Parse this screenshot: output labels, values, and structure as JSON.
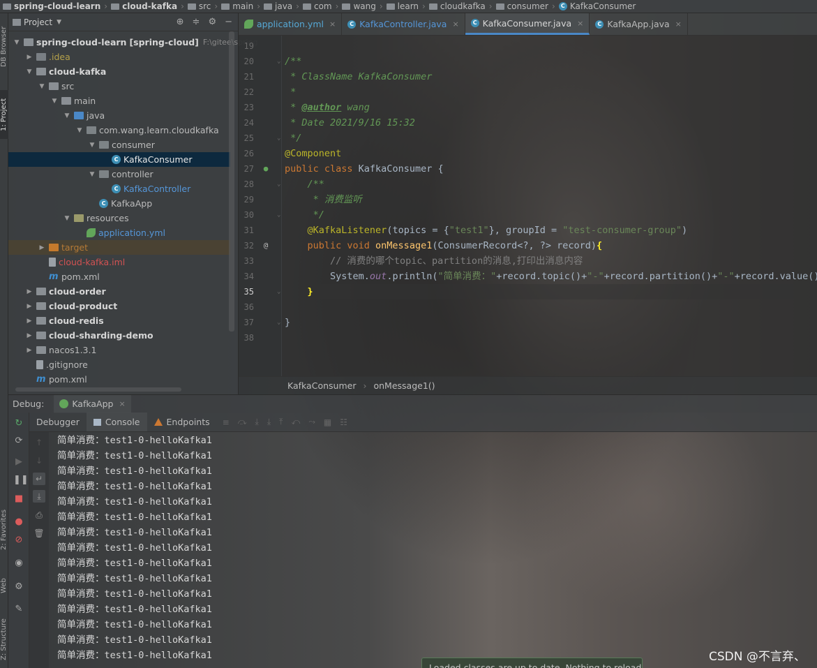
{
  "breadcrumb": [
    {
      "label": "spring-cloud-learn",
      "bold": true,
      "icon": "folder-icon"
    },
    {
      "label": "cloud-kafka",
      "bold": true,
      "icon": "folder-icon"
    },
    {
      "label": "src",
      "icon": "folder-icon"
    },
    {
      "label": "main",
      "icon": "folder-icon"
    },
    {
      "label": "java",
      "icon": "folder-icon"
    },
    {
      "label": "com",
      "icon": "folder-icon"
    },
    {
      "label": "wang",
      "icon": "folder-icon"
    },
    {
      "label": "learn",
      "icon": "folder-icon"
    },
    {
      "label": "cloudkafka",
      "icon": "folder-icon"
    },
    {
      "label": "consumer",
      "icon": "folder-icon"
    },
    {
      "label": "KafkaConsumer",
      "icon": "class-icon"
    }
  ],
  "left_stripe": {
    "db_browser": "DB Browser",
    "project": "1: Project",
    "favorites": "2: Favorites",
    "web": "Web",
    "structure": "Z: Structure"
  },
  "project_panel": {
    "title": "Project",
    "tree": [
      {
        "label": "spring-cloud-learn",
        "bold_suffix": "[spring-cloud]",
        "path": "F:\\gitee\\spring",
        "depth": 0,
        "expanded": true,
        "icon": "folder-icon",
        "style": "root"
      },
      {
        "label": ".idea",
        "depth": 1,
        "expanded": false,
        "icon": "folder-icon",
        "style": "yellow"
      },
      {
        "label": "cloud-kafka",
        "depth": 1,
        "expanded": true,
        "icon": "folder-icon",
        "style": "module"
      },
      {
        "label": "src",
        "depth": 2,
        "expanded": true,
        "icon": "folder-icon",
        "style": "plain"
      },
      {
        "label": "main",
        "depth": 3,
        "expanded": true,
        "icon": "folder-icon",
        "style": "plain"
      },
      {
        "label": "java",
        "depth": 4,
        "expanded": true,
        "icon": "folder-blue-icon",
        "style": "plain"
      },
      {
        "label": "com.wang.learn.cloudkafka",
        "depth": 5,
        "expanded": true,
        "icon": "package-icon",
        "style": "plain"
      },
      {
        "label": "consumer",
        "depth": 6,
        "expanded": true,
        "icon": "package-icon",
        "style": "plain"
      },
      {
        "label": "KafkaConsumer",
        "depth": 7,
        "icon": "class-icon",
        "style": "selected"
      },
      {
        "label": "controller",
        "depth": 6,
        "expanded": true,
        "icon": "package-icon",
        "style": "plain"
      },
      {
        "label": "KafkaController",
        "depth": 7,
        "icon": "class-icon",
        "style": "blue"
      },
      {
        "label": "KafkaApp",
        "depth": 6,
        "icon": "spring-class-icon",
        "style": "plain"
      },
      {
        "label": "resources",
        "depth": 4,
        "expanded": true,
        "icon": "resources-folder-icon",
        "style": "plain"
      },
      {
        "label": "application.yml",
        "depth": 5,
        "icon": "yml-icon",
        "style": "blue"
      },
      {
        "label": "target",
        "depth": 2,
        "expanded": false,
        "icon": "folder-orange-icon",
        "style": "target"
      },
      {
        "label": "cloud-kafka.iml",
        "depth": 2,
        "icon": "iml-file-icon",
        "style": "red"
      },
      {
        "label": "pom.xml",
        "depth": 2,
        "icon": "maven-icon",
        "style": "plain"
      },
      {
        "label": "cloud-order",
        "depth": 1,
        "expanded": false,
        "icon": "folder-icon",
        "style": "module"
      },
      {
        "label": "cloud-product",
        "depth": 1,
        "expanded": false,
        "icon": "folder-icon",
        "style": "module"
      },
      {
        "label": "cloud-redis",
        "depth": 1,
        "expanded": false,
        "icon": "folder-icon",
        "style": "module"
      },
      {
        "label": "cloud-sharding-demo",
        "depth": 1,
        "expanded": false,
        "icon": "folder-icon",
        "style": "module"
      },
      {
        "label": "nacos1.3.1",
        "depth": 1,
        "expanded": false,
        "icon": "folder-icon",
        "style": "plain"
      },
      {
        "label": ".gitignore",
        "depth": 1,
        "icon": "file-icon",
        "style": "plain"
      },
      {
        "label": "pom.xml",
        "depth": 1,
        "icon": "maven-icon",
        "style": "plain"
      }
    ]
  },
  "editor_tabs": [
    {
      "label": "application.yml",
      "icon": "yml-icon",
      "style": "yml"
    },
    {
      "label": "KafkaController.java",
      "icon": "class-icon",
      "style": "cls"
    },
    {
      "label": "KafkaConsumer.java",
      "icon": "class-icon",
      "style": "active"
    },
    {
      "label": "KafkaApp.java",
      "icon": "spring-class-icon",
      "style": "plain"
    }
  ],
  "code": {
    "current_line": 35,
    "lines": [
      {
        "no": 19,
        "tokens": []
      },
      {
        "no": 20,
        "tokens": [
          {
            "t": "/**",
            "c": "doc"
          }
        ]
      },
      {
        "no": 21,
        "tokens": [
          {
            "t": " * ClassName KafkaConsumer",
            "c": "doc"
          }
        ]
      },
      {
        "no": 22,
        "tokens": [
          {
            "t": " *",
            "c": "doc"
          }
        ]
      },
      {
        "no": 23,
        "tokens": [
          {
            "t": " * ",
            "c": "doc"
          },
          {
            "t": "@author",
            "c": "tag"
          },
          {
            "t": " wang",
            "c": "doc"
          }
        ]
      },
      {
        "no": 24,
        "tokens": [
          {
            "t": " * Date 2021/9/16 15:32",
            "c": "doc"
          }
        ]
      },
      {
        "no": 25,
        "tokens": [
          {
            "t": " */",
            "c": "doc"
          }
        ]
      },
      {
        "no": 26,
        "tokens": [
          {
            "t": "@Component",
            "c": "ann"
          }
        ]
      },
      {
        "no": 27,
        "tokens": [
          {
            "t": "public class ",
            "c": "kw"
          },
          {
            "t": "KafkaConsumer {",
            "c": "plain"
          }
        ]
      },
      {
        "no": 28,
        "tokens": [
          {
            "t": "    /**",
            "c": "doc"
          }
        ]
      },
      {
        "no": 29,
        "tokens": [
          {
            "t": "     * 消费监听",
            "c": "doc"
          }
        ]
      },
      {
        "no": 30,
        "tokens": [
          {
            "t": "     */",
            "c": "doc"
          }
        ]
      },
      {
        "no": 31,
        "tokens": [
          {
            "t": "    @KafkaListener",
            "c": "ann"
          },
          {
            "t": "(topics = {",
            "c": "plain"
          },
          {
            "t": "\"test1\"",
            "c": "str"
          },
          {
            "t": "}, groupId = ",
            "c": "plain"
          },
          {
            "t": "\"test-consumer-group\"",
            "c": "str"
          },
          {
            "t": ")",
            "c": "plain"
          }
        ]
      },
      {
        "no": 32,
        "tokens": [
          {
            "t": "    public void ",
            "c": "kw"
          },
          {
            "t": "onMessage1",
            "c": "fn"
          },
          {
            "t": "(ConsumerRecord<?, ?> record)",
            "c": "plain"
          },
          {
            "t": "{",
            "c": "brace"
          }
        ]
      },
      {
        "no": 33,
        "tokens": [
          {
            "t": "        // 消费的哪个topic、partition的消息,打印出消息内容",
            "c": "cmt"
          }
        ]
      },
      {
        "no": 34,
        "tokens": [
          {
            "t": "        System.",
            "c": "plain"
          },
          {
            "t": "out",
            "c": "static"
          },
          {
            "t": ".println(",
            "c": "plain"
          },
          {
            "t": "\"简单消费：\"",
            "c": "str"
          },
          {
            "t": "+record.topic()+",
            "c": "plain"
          },
          {
            "t": "\"-\"",
            "c": "str"
          },
          {
            "t": "+record.partition()+",
            "c": "plain"
          },
          {
            "t": "\"-\"",
            "c": "str"
          },
          {
            "t": "+record.value());",
            "c": "plain"
          }
        ]
      },
      {
        "no": 35,
        "tokens": [
          {
            "t": "    }",
            "c": "brace"
          }
        ]
      },
      {
        "no": 36,
        "tokens": []
      },
      {
        "no": 37,
        "tokens": [
          {
            "t": "}",
            "c": "plain"
          }
        ]
      },
      {
        "no": 38,
        "tokens": []
      }
    ]
  },
  "editor_breadcrumb": {
    "class_name": "KafkaConsumer",
    "method_name": "onMessage1()"
  },
  "debug": {
    "title": "Debug:",
    "run_config": "KafkaApp",
    "tabs": [
      {
        "label": "Debugger",
        "icon": "none"
      },
      {
        "label": "Console",
        "icon": "console-icon"
      },
      {
        "label": "Endpoints",
        "icon": "endpoints-icon"
      }
    ],
    "console_lines": [
      "简单消费：test1-0-helloKafka1",
      "简单消费：test1-0-helloKafka1",
      "简单消费：test1-0-helloKafka1",
      "简单消费：test1-0-helloKafka1",
      "简单消费：test1-0-helloKafka1",
      "简单消费：test1-0-helloKafka1",
      "简单消费：test1-0-helloKafka1",
      "简单消费：test1-0-helloKafka1",
      "简单消费：test1-0-helloKafka1",
      "简单消费：test1-0-helloKafka1",
      "简单消费：test1-0-helloKafka1",
      "简单消费：test1-0-helloKafka1",
      "简单消费：test1-0-helloKafka1",
      "简单消费：test1-0-helloKafka1",
      "简单消费：test1-0-helloKafka1"
    ]
  },
  "toast": "Loaded classes are up to date. Nothing to reload.",
  "watermark": "CSDN @不言弃、"
}
